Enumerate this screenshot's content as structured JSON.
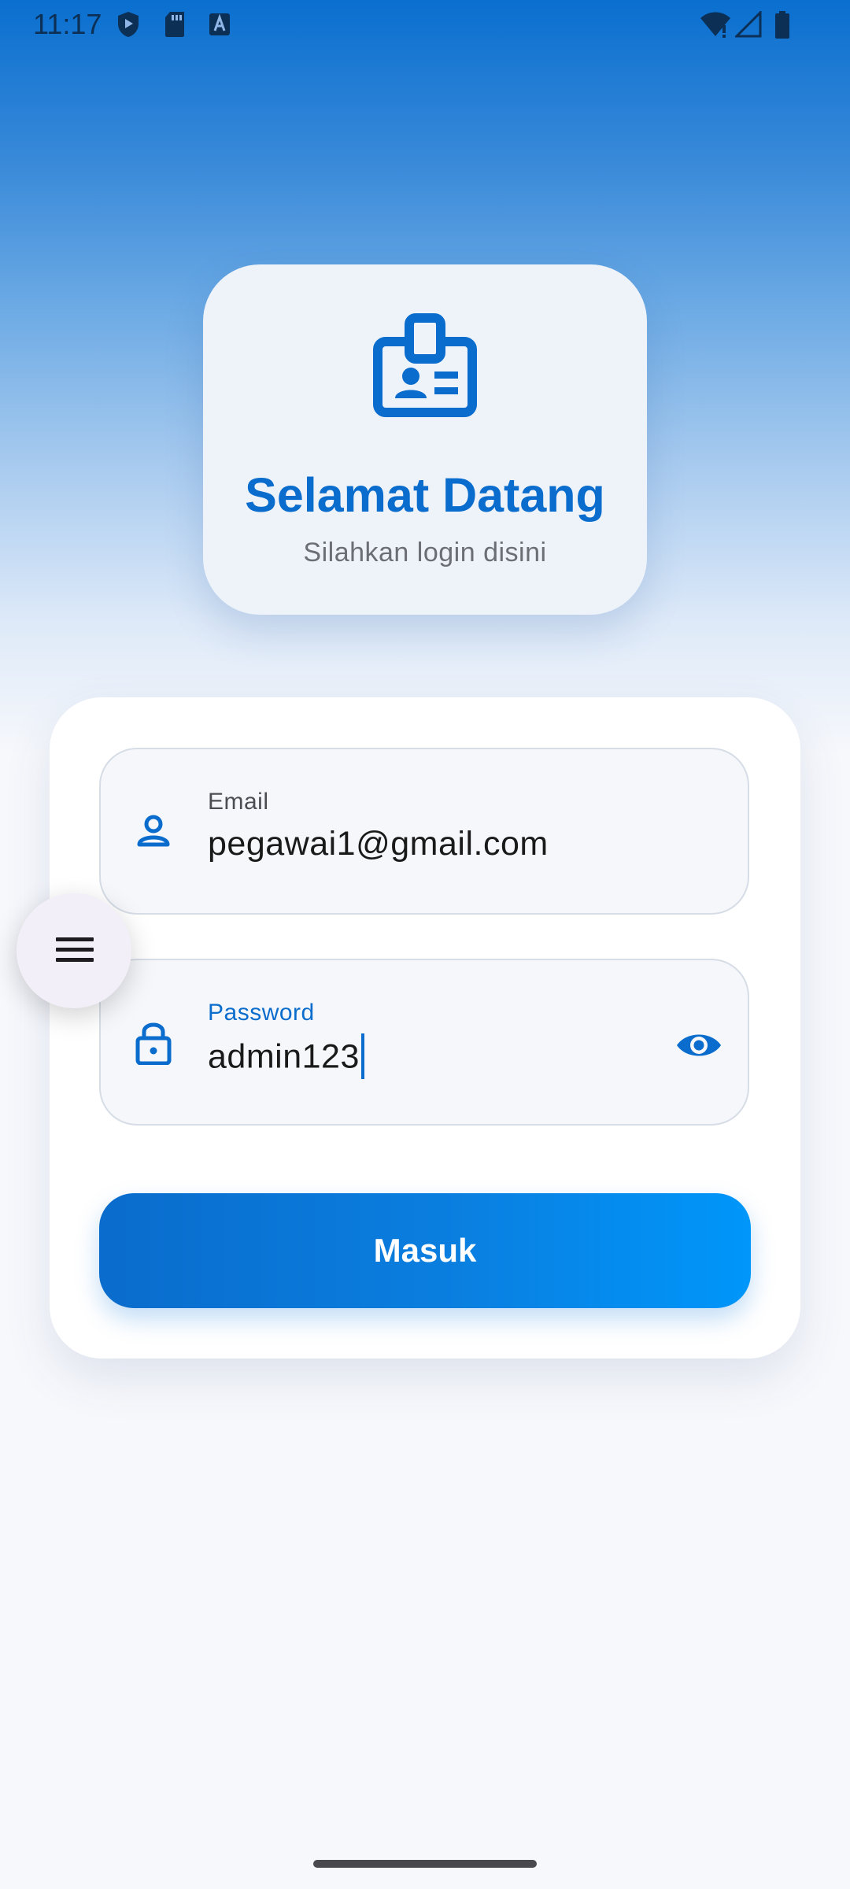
{
  "status_bar": {
    "time": "11:17"
  },
  "header": {
    "title": "Selamat Datang",
    "subtitle": "Silahkan login disini",
    "icon": "id-badge-icon"
  },
  "form": {
    "email": {
      "label": "Email",
      "value": "pegawai1@gmail.com",
      "icon": "person-icon"
    },
    "password": {
      "label": "Password",
      "value": "admin123",
      "icon": "lock-icon",
      "toggle_icon": "eye-icon"
    },
    "submit_label": "Masuk"
  },
  "menu": {
    "icon": "hamburger-menu-icon"
  },
  "colors": {
    "accent": "#0a6ccc",
    "button_gradient_end": "#0096fa",
    "background": "#f7f8fc"
  }
}
